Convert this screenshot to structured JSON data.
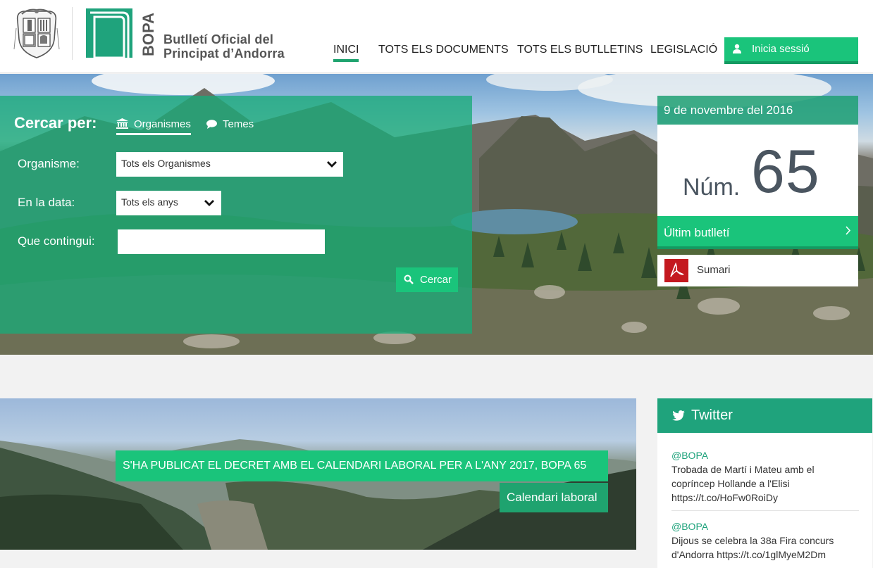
{
  "header": {
    "brand_line1": "Butlletí Oficial del",
    "brand_line2": "Principat d’Andorra",
    "logo_text": "BOPA",
    "nav": [
      {
        "label": "INICI",
        "active": true
      },
      {
        "label": "TOTS ELS DOCUMENTS",
        "active": false
      },
      {
        "label": "TOTS ELS BUTLLETINS",
        "active": false
      },
      {
        "label": "LEGISLACIÓ",
        "active": false
      }
    ],
    "login_label": "Inicia sessió",
    "login_icon": "user-icon"
  },
  "search": {
    "title": "Cercar per:",
    "tabs": [
      {
        "label": "Organismes",
        "icon": "institution-icon",
        "active": true
      },
      {
        "label": "Temes",
        "icon": "speech-bubble-icon",
        "active": false
      }
    ],
    "organisme_label": "Organisme:",
    "organisme_value": "Tots els Organismes",
    "data_label": "En la data:",
    "data_value": "Tots els anys",
    "text_label": "Que contingui:",
    "text_value": "",
    "button_label": "Cercar",
    "button_icon": "search-icon"
  },
  "bulletin": {
    "date": "9 de novembre del 2016",
    "num_label": "Núm.",
    "num_value": "65",
    "last_label": "Últim butlletí",
    "sumari_label": "Sumari",
    "sumari_icon": "pdf-icon"
  },
  "feature": {
    "title": "S'HA PUBLICAT EL DECRET AMB EL CALENDARI LABORAL PER A L'ANY 2017, BOPA 65",
    "tag": "Calendari laboral"
  },
  "twitter": {
    "title": "Twitter",
    "icon": "twitter-bird-icon",
    "tweets": [
      {
        "handle": "@BOPA",
        "line1": "Trobada de Martí i Mateu amb el",
        "line2": "copríncep Hollande a l'Elisi",
        "line3": "https://t.co/HoFw0RoiDy"
      },
      {
        "handle": "@BOPA",
        "line1": "Dijous se celebra la 38a Fira concurs",
        "line2": "d'Andorra https://t.co/1glMyeM2Dm",
        "line3": ""
      }
    ]
  },
  "colors": {
    "brand_green": "#1ac47b",
    "brand_dark_green": "#1fa36f",
    "twitter_green": "#1fa37c",
    "pdf_red": "#c4191f"
  }
}
